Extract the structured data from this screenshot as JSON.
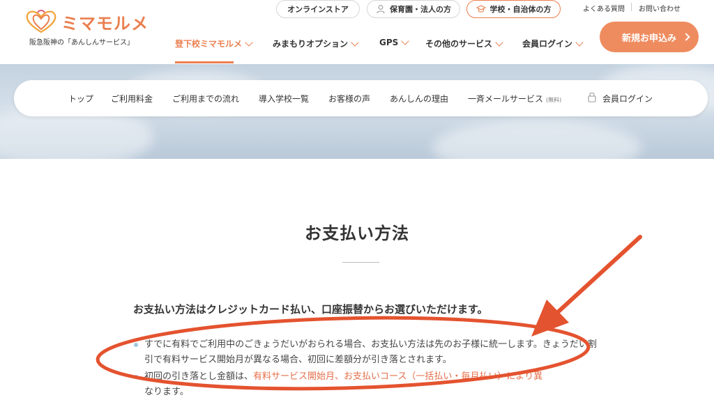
{
  "brand": {
    "name": "ミマモルメ",
    "tagline": "阪急阪神の「あんしんサービス」"
  },
  "top_links": {
    "online_store": "オンラインストア",
    "nursery": "保育園・法人の方",
    "school": "学校・自治体の方",
    "faq": "よくある質問",
    "contact": "お問い合わせ"
  },
  "main_nav": [
    {
      "label": "登下校ミマモルメ"
    },
    {
      "label": "みまもりオプション"
    },
    {
      "label": "GPS"
    },
    {
      "label": "その他のサービス"
    },
    {
      "label": "会員ログイン"
    }
  ],
  "cta": {
    "label": "新規お申込み"
  },
  "sub_nav": [
    {
      "label": "トップ"
    },
    {
      "label": "ご利用料金"
    },
    {
      "label": "ご利用までの流れ"
    },
    {
      "label": "導入学校一覧"
    },
    {
      "label": "お客様の声"
    },
    {
      "label": "あんしんの理由"
    },
    {
      "label": "一斉メールサービス",
      "note": "(無料)"
    },
    {
      "label": "会員ログイン"
    }
  ],
  "page": {
    "title": "お支払い方法",
    "lead": "お支払い方法はクレジットカード払い、口座振替からお選びいただけます。",
    "bullets": [
      {
        "text": "すでに有料でご利用中のごきょうだいがおられる場合、お支払い方法は先のお子様に統一します。きょうだい割引で有料サービス開始月が異なる場合、初回に差額分が引き落とされます。"
      },
      {
        "prefix": "初回の引き落とし金額は、",
        "highlight": "有料サービス開始月、お支払いコース（一括払い・毎月払い）により異",
        "suffix": "なります。"
      }
    ]
  },
  "colors": {
    "accent": "#ea7f4f",
    "cta_bg": "#ef8c5f",
    "annotation": "#e4532f",
    "bullet_dot": "#9fc7e0"
  }
}
